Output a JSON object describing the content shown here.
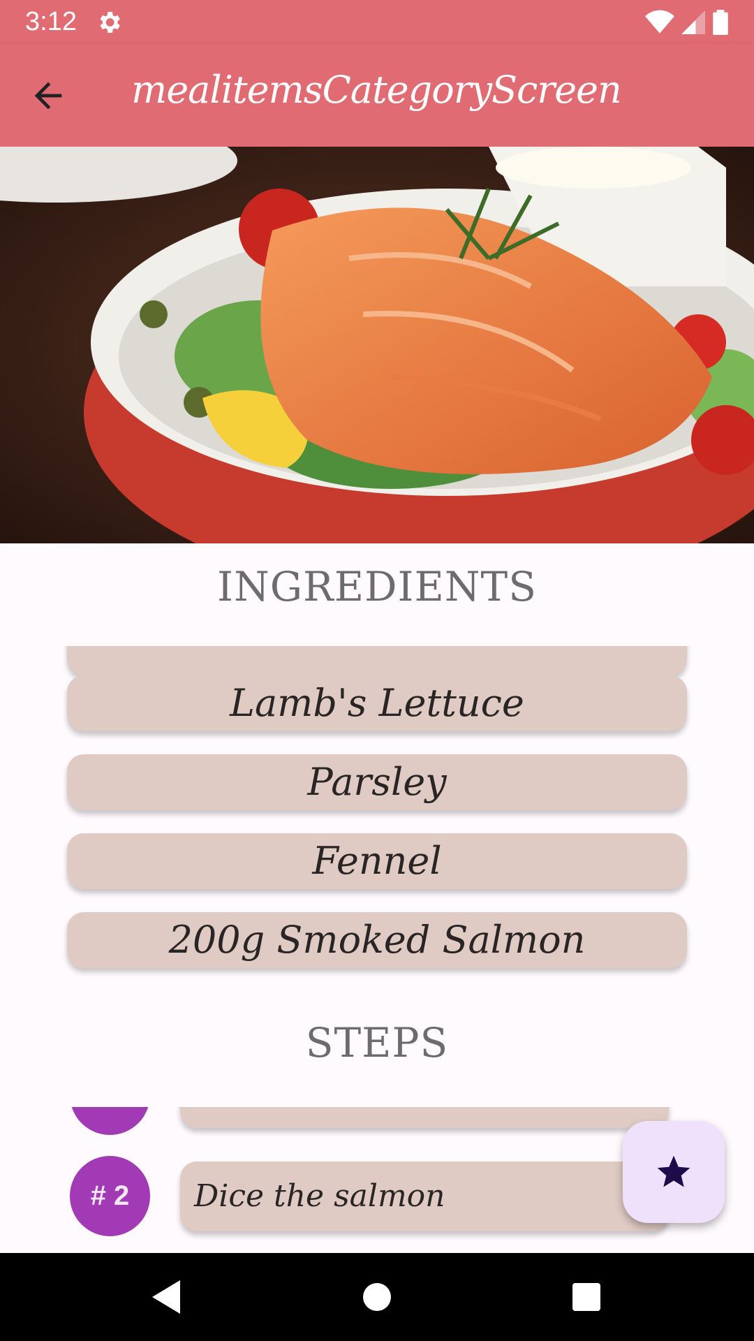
{
  "status_bar": {
    "time": "3:12"
  },
  "app_bar": {
    "title": "mealitemsCategoryScreen"
  },
  "ingredients": {
    "header": "INGREDIENTS",
    "items": [
      "Lamb's Lettuce",
      "Parsley",
      "Fennel",
      "200g Smoked Salmon"
    ]
  },
  "steps": {
    "header": "STEPS",
    "items": [
      {
        "number": "# 2",
        "text": "Dice the salmon"
      }
    ]
  },
  "fab": {
    "icon": "star-icon"
  },
  "colors": {
    "app_bar": "#e06b72",
    "pill": "#e0cbc4",
    "step_badge": "#a23ab6",
    "fab": "#efe0fb"
  }
}
